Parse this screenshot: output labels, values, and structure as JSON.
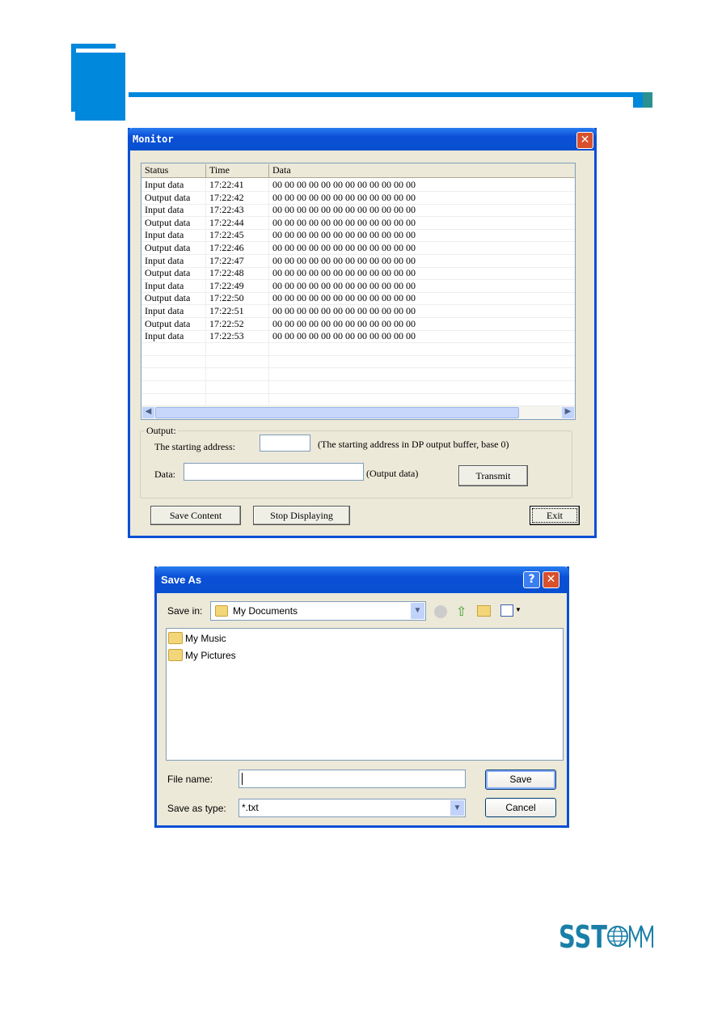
{
  "monitor": {
    "title": "Monitor",
    "columns": [
      "Status",
      "Time",
      "Data"
    ],
    "rows": [
      [
        "Input data",
        "17:22:41",
        "00 00 00 00 00 00 00 00 00 00 00 00"
      ],
      [
        "Output data",
        "17:22:42",
        "00 00 00 00 00 00 00 00 00 00 00 00"
      ],
      [
        "Input data",
        "17:22:43",
        "00 00 00 00 00 00 00 00 00 00 00 00"
      ],
      [
        "Output data",
        "17:22:44",
        "00 00 00 00 00 00 00 00 00 00 00 00"
      ],
      [
        "Input data",
        "17:22:45",
        "00 00 00 00 00 00 00 00 00 00 00 00"
      ],
      [
        "Output data",
        "17:22:46",
        "00 00 00 00 00 00 00 00 00 00 00 00"
      ],
      [
        "Input data",
        "17:22:47",
        "00 00 00 00 00 00 00 00 00 00 00 00"
      ],
      [
        "Output data",
        "17:22:48",
        "00 00 00 00 00 00 00 00 00 00 00 00"
      ],
      [
        "Input data",
        "17:22:49",
        "00 00 00 00 00 00 00 00 00 00 00 00"
      ],
      [
        "Output data",
        "17:22:50",
        "00 00 00 00 00 00 00 00 00 00 00 00"
      ],
      [
        "Input data",
        "17:22:51",
        "00 00 00 00 00 00 00 00 00 00 00 00"
      ],
      [
        "Output data",
        "17:22:52",
        "00 00 00 00 00 00 00 00 00 00 00 00"
      ],
      [
        "Input data",
        "17:22:53",
        "00 00 00 00 00 00 00 00 00 00 00 00"
      ]
    ],
    "output_group": "Output:",
    "start_address_label": "The starting address:",
    "start_address_value": "",
    "start_address_hint": "(The starting address in DP output buffer, base 0)",
    "data_label": "Data:",
    "data_value": "",
    "data_hint": "(Output data)",
    "transmit": "Transmit",
    "save_content": "Save Content",
    "stop_displaying": "Stop Displaying",
    "exit": "Exit"
  },
  "save_as": {
    "title": "Save As",
    "save_in_label": "Save in:",
    "save_in_value": "My Documents",
    "items": [
      "My Music",
      "My Pictures"
    ],
    "file_name_label": "File name:",
    "file_name_value": "",
    "type_label": "Save as type:",
    "type_value": "*.txt",
    "save": "Save",
    "cancel": "Cancel"
  },
  "logo": "SSTCOMM",
  "colors": {
    "accent": "#0088dd",
    "teal": "#2a9090",
    "logo": "#1a7fa8"
  }
}
